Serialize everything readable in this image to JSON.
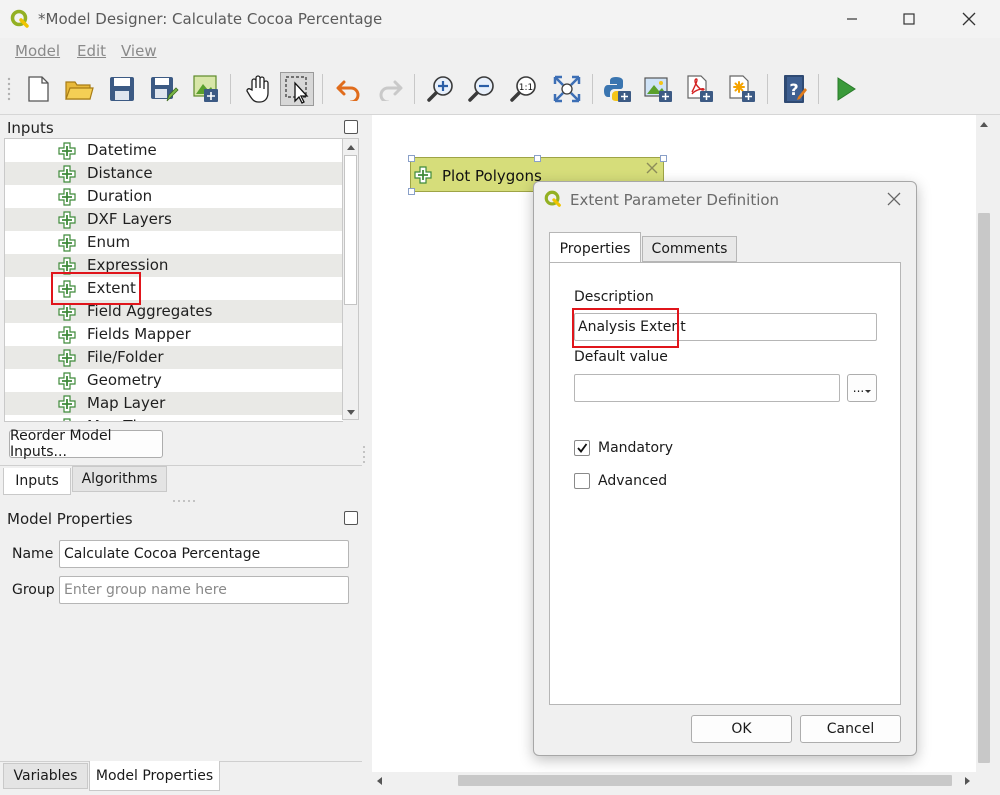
{
  "window": {
    "title": "*Model Designer: Calculate Cocoa Percentage",
    "controls": [
      "minimize",
      "maximize",
      "close"
    ]
  },
  "menubar": {
    "items": [
      {
        "label": "Model"
      },
      {
        "label": "Edit"
      },
      {
        "label": "View"
      }
    ]
  },
  "toolbar": {
    "icons": [
      "new-model-icon",
      "open-model-icon",
      "save-model-icon",
      "save-as-icon",
      "save-to-project-icon",
      "pan-icon",
      "select-icon",
      "undo-icon",
      "redo-icon",
      "zoom-in-icon",
      "zoom-out-icon",
      "zoom-actual-icon",
      "zoom-full-icon",
      "export-python-icon",
      "export-image-icon",
      "export-pdf-icon",
      "export-svg-icon",
      "help-icon",
      "run-model-icon"
    ]
  },
  "inputs_panel": {
    "title": "Inputs",
    "items": [
      {
        "label": "Datetime"
      },
      {
        "label": "Distance"
      },
      {
        "label": "Duration"
      },
      {
        "label": "DXF Layers"
      },
      {
        "label": "Enum"
      },
      {
        "label": "Expression"
      },
      {
        "label": "Extent"
      },
      {
        "label": "Field Aggregates"
      },
      {
        "label": "Fields Mapper"
      },
      {
        "label": "File/Folder"
      },
      {
        "label": "Geometry"
      },
      {
        "label": "Map Layer"
      },
      {
        "label": "Map Theme"
      }
    ],
    "reorder_button": "Reorder Model Inputs...",
    "tabs": [
      {
        "label": "Inputs"
      },
      {
        "label": "Algorithms"
      }
    ]
  },
  "model_properties": {
    "title": "Model Properties",
    "name_label": "Name",
    "name_value": "Calculate Cocoa Percentage",
    "group_label": "Group",
    "group_placeholder": "Enter group name here"
  },
  "bottom_tabs": [
    {
      "label": "Variables"
    },
    {
      "label": "Model Properties"
    }
  ],
  "canvas": {
    "node_label": "Plot Polygons"
  },
  "dialog": {
    "title": "Extent Parameter Definition",
    "tabs": [
      {
        "label": "Properties"
      },
      {
        "label": "Comments"
      }
    ],
    "description_label": "Description",
    "description_value": "Analysis Extent",
    "default_value_label": "Default value",
    "default_value": "",
    "browse_button": "...",
    "mandatory_label": "Mandatory",
    "mandatory_checked": true,
    "advanced_label": "Advanced",
    "advanced_checked": false,
    "ok_button": "OK",
    "cancel_button": "Cancel"
  },
  "colors": {
    "highlight": "#e0151b",
    "node_fill": "#d6dd7a",
    "plus_green": "#3f8a3a"
  }
}
